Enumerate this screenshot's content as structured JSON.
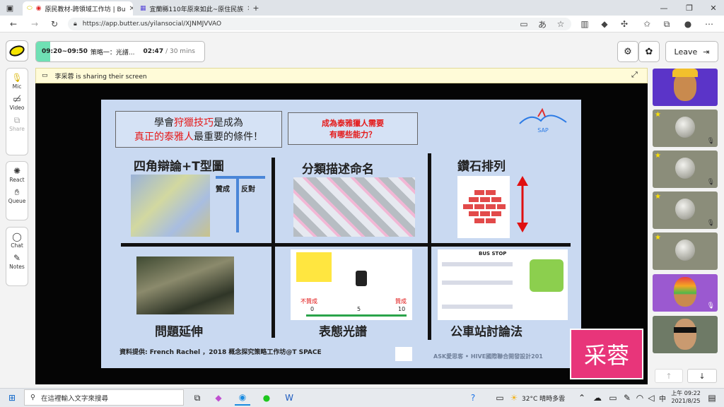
{
  "browser": {
    "tabs": [
      {
        "title": "原民教材-跨領域工作坊 | Bu",
        "active": true
      },
      {
        "title": "宜蘭縣110年原來如此~原住民族",
        "active": false
      }
    ],
    "url": "https://app.butter.us/yilansocial/XJNMJVVAO"
  },
  "session": {
    "agenda_time": "09:20~09:50",
    "agenda_title": "策略一：光譜...",
    "elapsed": "02:47",
    "total": "/ 30 mins",
    "leave_label": "Leave"
  },
  "toolbar": {
    "items": [
      {
        "label": "Mic",
        "icon": "mic-icon"
      },
      {
        "label": "Video",
        "icon": "video-off-icon"
      },
      {
        "label": "Share",
        "icon": "share-icon"
      },
      {
        "label": "React",
        "icon": "react-icon"
      },
      {
        "label": "Queue",
        "icon": "hand-icon"
      },
      {
        "label": "Chat",
        "icon": "chat-icon"
      },
      {
        "label": "Notes",
        "icon": "pencil-icon"
      }
    ]
  },
  "share": {
    "banner": "李采蓉 is sharing their screen"
  },
  "slide": {
    "title_box_line1_a": "學會",
    "title_box_line1_b": "狩獵技巧",
    "title_box_line1_c": "是成為",
    "title_box_line2_a": "真正的泰雅人",
    "title_box_line2_b": "最重要的條件！",
    "question_box_line1": "成為泰雅獵人需要",
    "question_box_line2": "有哪些能力？",
    "logo_sap": "SAP",
    "cell1_title": "四角辯論+T型圖",
    "cell1_label_a": "贊成",
    "cell1_label_b": "反對",
    "cell2_title": "分類描述命名",
    "cell3_title": "鑽石排列",
    "cell4_title": "問題延伸",
    "cell5_title": "表態光譜",
    "cell5_left": "不贊成",
    "cell5_right": "贊成",
    "cell5_ticks": [
      "0",
      "5",
      "10"
    ],
    "cell6_title": "公車站討論法",
    "cell6_header": "BUS  STOP",
    "footer_left": "資料提供: French Rachel ，2018 概念探究策略工作坊@T SPACE",
    "footer_right": "ASK愛思客 • HIVE國際聯合開發設計201",
    "name_badge": "采蓉"
  },
  "participants": [
    {
      "kind": "self-avatar",
      "star": false,
      "muted": false
    },
    {
      "kind": "default-avatar",
      "star": true,
      "muted": true
    },
    {
      "kind": "default-avatar",
      "star": true,
      "muted": true
    },
    {
      "kind": "default-avatar",
      "star": true,
      "muted": true
    },
    {
      "kind": "default-avatar",
      "star": true,
      "muted": false
    },
    {
      "kind": "rainbow-avatar",
      "star": false,
      "muted": false
    },
    {
      "kind": "glasses-avatar",
      "star": false,
      "muted": false
    }
  ],
  "taskbar": {
    "search_placeholder": "在這裡輸入文字來搜尋",
    "weather": "32°C 晴時多雲",
    "ime": "中",
    "time": "上午 09:22",
    "date": "2021/8/25"
  },
  "colors": {
    "accent_green": "#6fe0b4",
    "badge_pink": "#e8357a",
    "slide_bg": "#c9d9f1"
  }
}
